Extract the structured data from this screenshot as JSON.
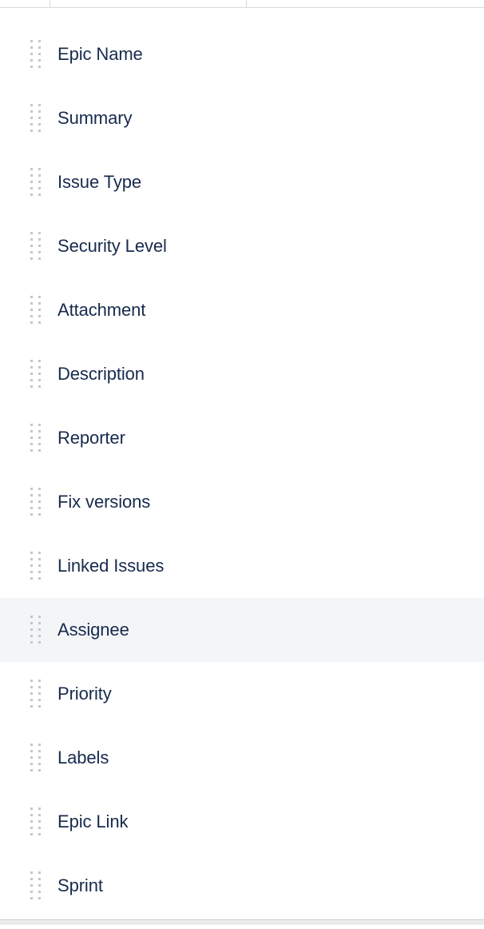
{
  "fields": [
    {
      "label": "Epic Name",
      "selected": false
    },
    {
      "label": "Summary",
      "selected": false
    },
    {
      "label": "Issue Type",
      "selected": false
    },
    {
      "label": "Security Level",
      "selected": false
    },
    {
      "label": "Attachment",
      "selected": false
    },
    {
      "label": "Description",
      "selected": false
    },
    {
      "label": "Reporter",
      "selected": false
    },
    {
      "label": "Fix versions",
      "selected": false
    },
    {
      "label": "Linked Issues",
      "selected": false
    },
    {
      "label": "Assignee",
      "selected": true
    },
    {
      "label": "Priority",
      "selected": false
    },
    {
      "label": "Labels",
      "selected": false
    },
    {
      "label": "Epic Link",
      "selected": false
    },
    {
      "label": "Sprint",
      "selected": false
    }
  ]
}
